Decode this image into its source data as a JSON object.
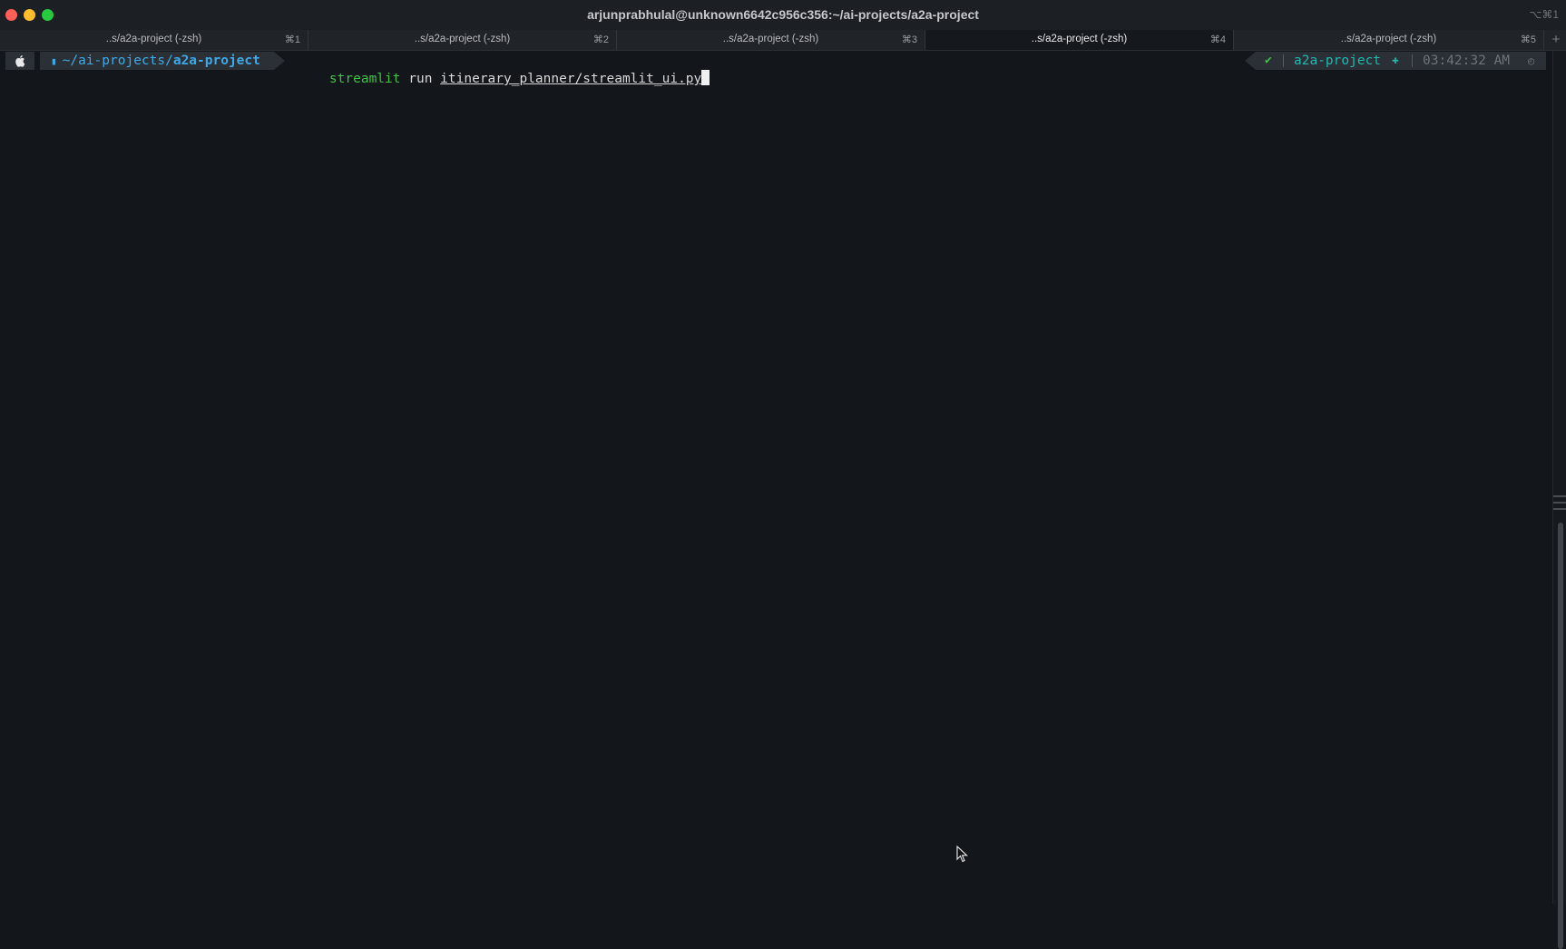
{
  "window": {
    "title": "arjunprabhulal@unknown6642c956c356:~/ai-projects/a2a-project",
    "shortcut": "⌥⌘1"
  },
  "tabs": [
    {
      "label": "..s/a2a-project (-zsh)",
      "key": "⌘1",
      "active": false
    },
    {
      "label": "..s/a2a-project (-zsh)",
      "key": "⌘2",
      "active": false
    },
    {
      "label": "..s/a2a-project (-zsh)",
      "key": "⌘3",
      "active": false
    },
    {
      "label": "..s/a2a-project (-zsh)",
      "key": "⌘4",
      "active": true
    },
    {
      "label": "..s/a2a-project (-zsh)",
      "key": "⌘5",
      "active": false
    }
  ],
  "tab_add_label": "+",
  "prompt": {
    "os_icon": "apple-icon",
    "dir_prefix": "~/ai-projects/",
    "dir_name": "a2a-project",
    "command": "streamlit",
    "arg": "run",
    "file": "itinerary_planner/streamlit_ui.py"
  },
  "right_prompt": {
    "status": "✔",
    "env": "a2a-project",
    "env_icon": "python-icon",
    "time": "03:42:32 AM",
    "clock_icon": "clock-icon"
  },
  "colors": {
    "background": "#13161b",
    "path": "#3fa9e6",
    "command": "#3ec144",
    "env": "#20b8b0"
  }
}
